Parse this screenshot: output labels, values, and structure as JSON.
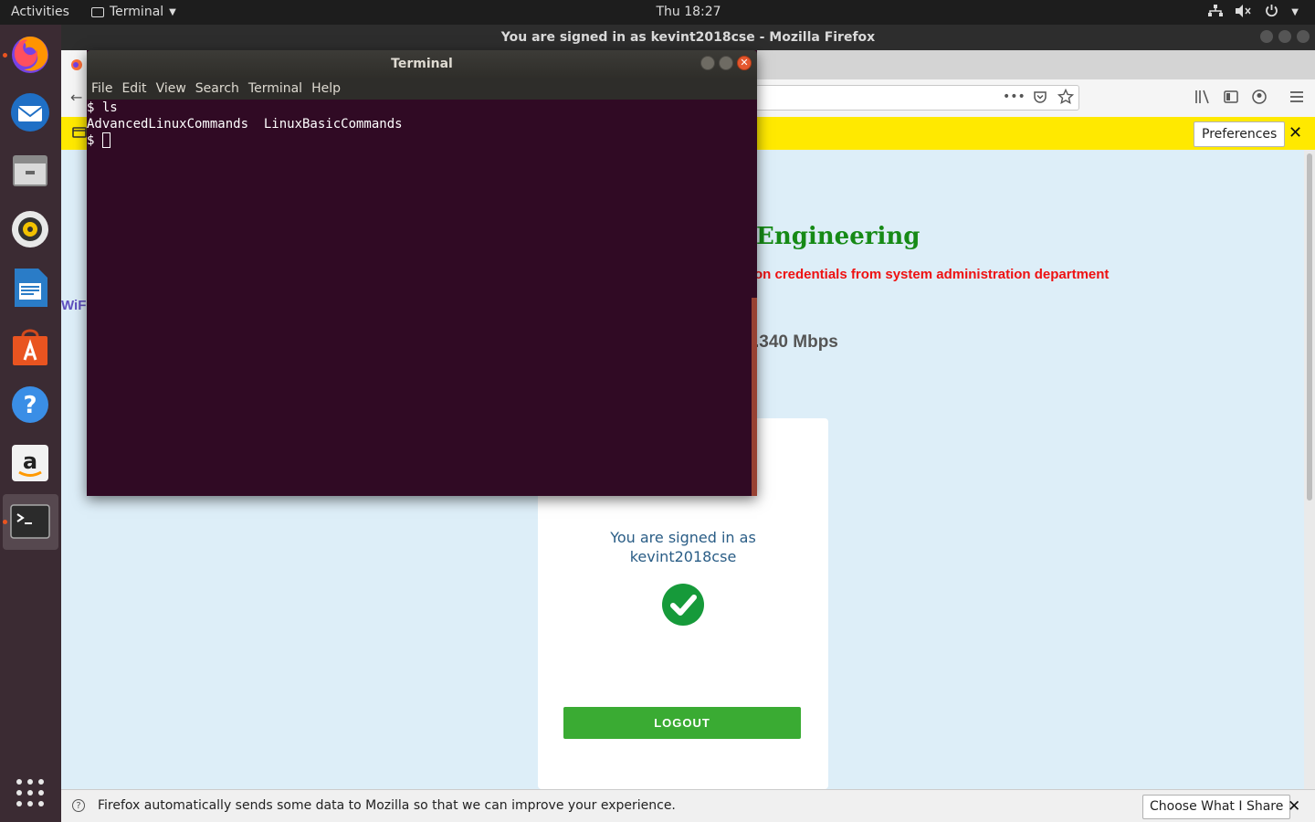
{
  "topbar": {
    "activities": "Activities",
    "app_name": "Terminal",
    "clock": "Thu 18:27"
  },
  "dock": {
    "items": [
      "firefox",
      "thunderbird",
      "files",
      "rhythmbox",
      "libreoffice-writer",
      "ubuntu-software",
      "help",
      "amazon",
      "terminal",
      "show-applications"
    ]
  },
  "firefox": {
    "window_title": "You are signed in as kevint2018cse - Mozilla Firefox",
    "notice_button": "Preferences",
    "page": {
      "heading": "Engineering",
      "red_text": "on credentials from system administration department",
      "speed": ".340 Mbps",
      "wifi": "WiFi",
      "signed_in_line1": "You are signed in as",
      "signed_in_line2": "kevint2018cse",
      "logout": "LOGOUT"
    },
    "databar": {
      "message": "Firefox automatically sends some data to Mozilla so that we can improve your experience.",
      "button": "Choose What I Share"
    }
  },
  "terminal": {
    "title": "Terminal",
    "menu": [
      "File",
      "Edit",
      "View",
      "Search",
      "Terminal",
      "Help"
    ],
    "lines": [
      "$ ls",
      "AdvancedLinuxCommands  LinuxBasicCommands"
    ],
    "prompt": "$ "
  },
  "colors": {
    "terminal_bg": "#300a24",
    "notice_bar": "#ffe900",
    "logout_green": "#3aab33",
    "heading_green": "#168a16",
    "alert_red": "#ee1111"
  }
}
